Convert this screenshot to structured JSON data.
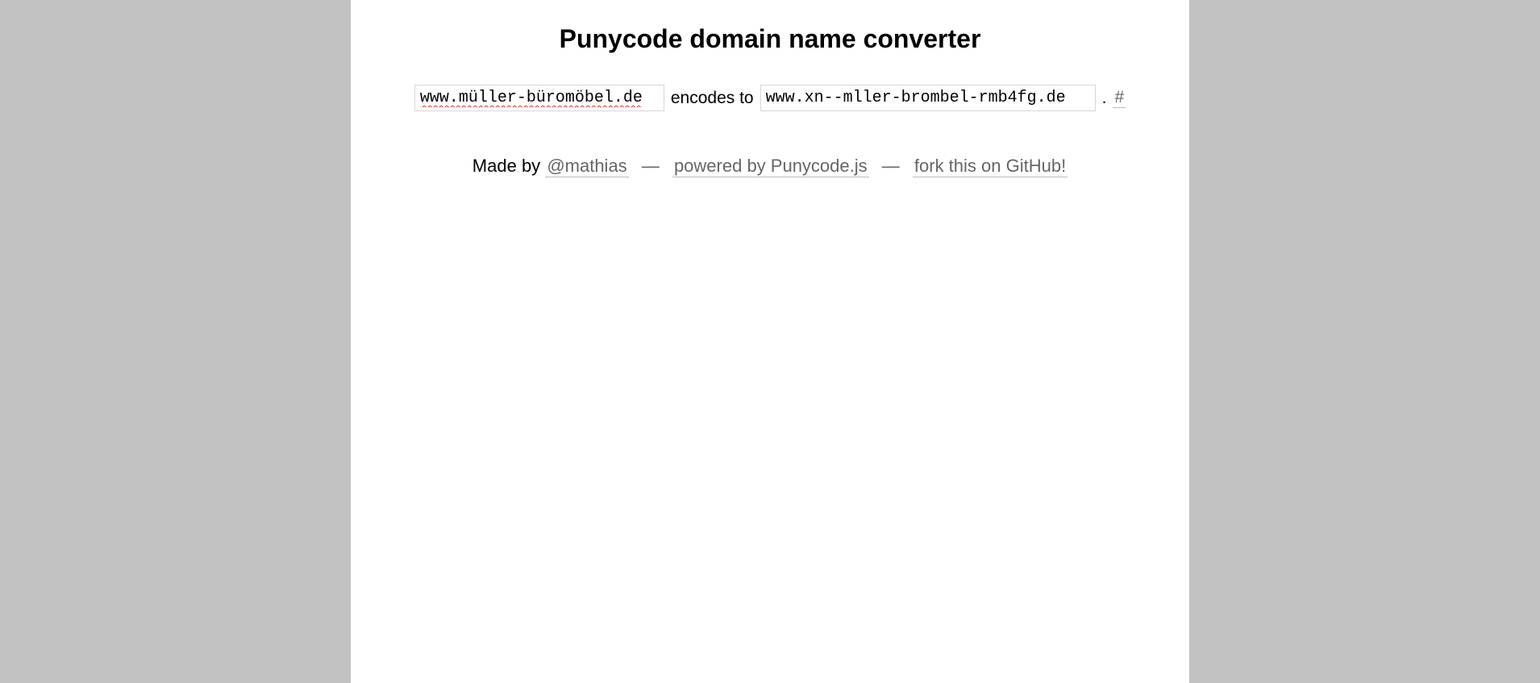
{
  "title": "Punycode domain name converter",
  "converter": {
    "decoded_value": "www.müller-büromöbel.de",
    "encodes_label": "encodes to",
    "encoded_value": "www.xn--mller-brombel-rmb4fg.de",
    "period": ".",
    "permalink": "#"
  },
  "footer": {
    "made_by": "Made by",
    "author": "@mathias",
    "sep": "—",
    "powered_by": "powered by Punycode.js",
    "fork": "fork this on GitHub!"
  }
}
